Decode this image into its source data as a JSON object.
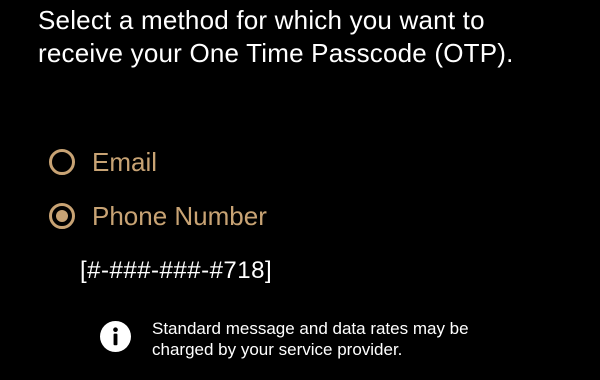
{
  "prompt": {
    "line1": "Select a method for which you want to",
    "line2": "receive your One Time Passcode (OTP)."
  },
  "otp_method": {
    "selected": "phone",
    "options": [
      {
        "id": "email",
        "label": "Email",
        "selected": false
      },
      {
        "id": "phone",
        "label": "Phone Number",
        "selected": true
      }
    ],
    "phone_masked": "[#-###-###-#718]"
  },
  "notice": {
    "icon": "info-icon",
    "line1": "Standard message and data rates may be",
    "line2": "charged by your service provider."
  },
  "colors": {
    "background": "#000000",
    "accent": "#c8a374",
    "text": "#ffffff"
  }
}
